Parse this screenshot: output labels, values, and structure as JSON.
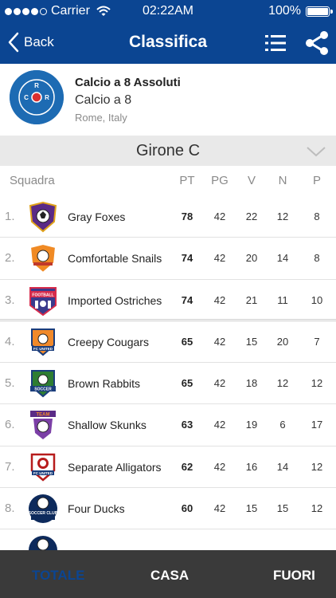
{
  "status": {
    "carrier": "Carrier",
    "time": "02:22AM",
    "battery": "100%"
  },
  "nav": {
    "back_label": "Back",
    "title": "Classifica"
  },
  "league": {
    "name": "Calcio a 8 Assoluti",
    "category": "Calcio a 8",
    "location": "Rome, Italy",
    "logo_letters": [
      "R",
      "C",
      "R"
    ],
    "accent": "#1d6bb3"
  },
  "group": {
    "title": "Girone C"
  },
  "table": {
    "headers": {
      "squadra": "Squadra",
      "pt": "PT",
      "pg": "PG",
      "v": "V",
      "n": "N",
      "p": "P"
    },
    "rows": [
      {
        "rank": "1.",
        "team": "Gray Foxes",
        "pt": "78",
        "pg": "42",
        "v": "22",
        "n": "12",
        "p": "8",
        "badge": "purple-shield"
      },
      {
        "rank": "2.",
        "team": "Comfortable Snails",
        "pt": "74",
        "pg": "42",
        "v": "20",
        "n": "14",
        "p": "8",
        "badge": "orange-shield"
      },
      {
        "rank": "3.",
        "team": "Imported Ostriches",
        "pt": "74",
        "pg": "42",
        "v": "21",
        "n": "11",
        "p": "10",
        "badge": "football-crest"
      },
      {
        "rank": "4.",
        "team": "Creepy Cougars",
        "pt": "65",
        "pg": "42",
        "v": "15",
        "n": "20",
        "p": "7",
        "badge": "fc-united"
      },
      {
        "rank": "5.",
        "team": "Brown Rabbits",
        "pt": "65",
        "pg": "42",
        "v": "18",
        "n": "12",
        "p": "12",
        "badge": "soccer-green"
      },
      {
        "rank": "6.",
        "team": "Shallow Skunks",
        "pt": "63",
        "pg": "42",
        "v": "19",
        "n": "6",
        "p": "17",
        "badge": "team-purple"
      },
      {
        "rank": "7.",
        "team": "Separate Alligators",
        "pt": "62",
        "pg": "42",
        "v": "16",
        "n": "14",
        "p": "12",
        "badge": "fc-united-red"
      },
      {
        "rank": "8.",
        "team": "Four Ducks",
        "pt": "60",
        "pg": "42",
        "v": "15",
        "n": "15",
        "p": "12",
        "badge": "soccer-club"
      }
    ]
  },
  "badge_texts": {
    "football": "FOOTBALL",
    "fc_united": "FC UNITED",
    "soccer": "SOCCER",
    "team": "TEAM",
    "soccer_club": "SOCCER CLUB"
  },
  "tabs": {
    "totale": "TOTALE",
    "casa": "CASA",
    "fuori": "FUORI"
  },
  "colors": {
    "brand": "#0b4592",
    "tab_bar": "#3a3a3a",
    "group_bar": "#e9e9e9"
  }
}
